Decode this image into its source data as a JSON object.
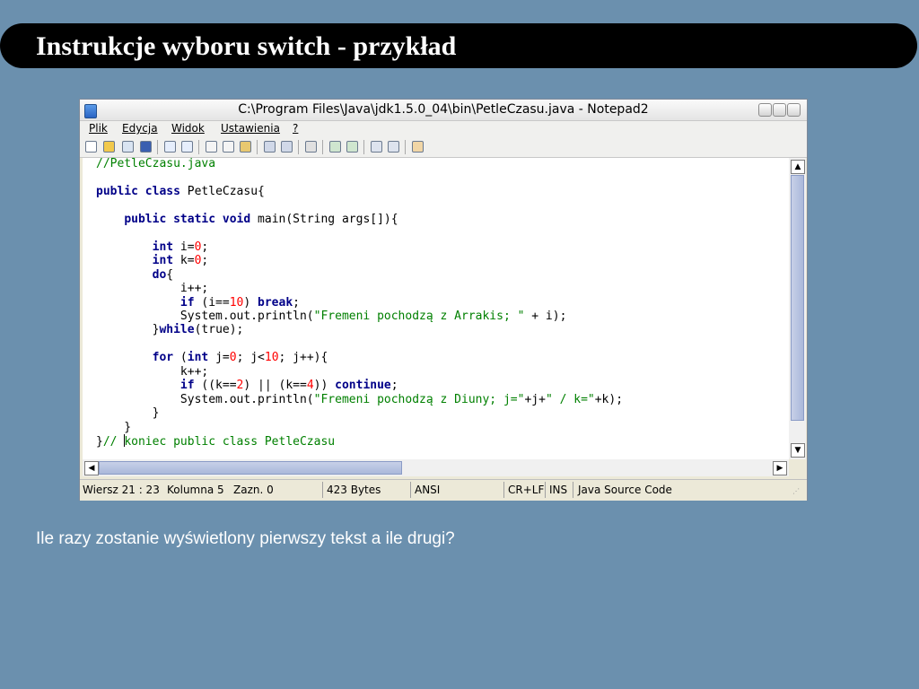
{
  "slide": {
    "title": "Instrukcje wyboru switch - przykład",
    "question": "Ile razy zostanie wyświetlony pierwszy tekst a ile drugi?"
  },
  "window": {
    "title": "C:\\Program Files\\Java\\jdk1.5.0_04\\bin\\PetleCzasu.java - Notepad2",
    "menu": [
      "Plik",
      "Edycja",
      "Widok",
      "Ustawienia",
      "?"
    ]
  },
  "statusbar": {
    "position": "Wiersz 21 : 23",
    "column": "Kolumna 5",
    "selection": "Zazn. 0",
    "size": "423 Bytes",
    "encoding": "ANSI",
    "line_endings": "CR+LF",
    "mode": "INS",
    "language": "Java Source Code"
  },
  "code": {
    "lines": [
      [
        {
          "t": "//PetleCzasu.java",
          "c": "com"
        }
      ],
      [],
      [
        {
          "t": "public",
          "c": "kw"
        },
        {
          "t": " "
        },
        {
          "t": "class",
          "c": "kw"
        },
        {
          "t": " PetleCzasu{"
        }
      ],
      [],
      [
        {
          "t": "    "
        },
        {
          "t": "public",
          "c": "kw"
        },
        {
          "t": " "
        },
        {
          "t": "static",
          "c": "kw"
        },
        {
          "t": " "
        },
        {
          "t": "void",
          "c": "kw"
        },
        {
          "t": " main(String args[]){"
        }
      ],
      [],
      [
        {
          "t": "        "
        },
        {
          "t": "int",
          "c": "kw"
        },
        {
          "t": " i="
        },
        {
          "t": "0",
          "c": "num"
        },
        {
          "t": ";"
        }
      ],
      [
        {
          "t": "        "
        },
        {
          "t": "int",
          "c": "kw"
        },
        {
          "t": " k="
        },
        {
          "t": "0",
          "c": "num"
        },
        {
          "t": ";"
        }
      ],
      [
        {
          "t": "        "
        },
        {
          "t": "do",
          "c": "kw"
        },
        {
          "t": "{"
        }
      ],
      [
        {
          "t": "            i++;"
        }
      ],
      [
        {
          "t": "            "
        },
        {
          "t": "if",
          "c": "kw"
        },
        {
          "t": " (i=="
        },
        {
          "t": "10",
          "c": "num"
        },
        {
          "t": ") "
        },
        {
          "t": "break",
          "c": "kw"
        },
        {
          "t": ";"
        }
      ],
      [
        {
          "t": "            System.out.println("
        },
        {
          "t": "\"Fremeni pochodzą z Arrakis; \"",
          "c": "str"
        },
        {
          "t": " + i);"
        }
      ],
      [
        {
          "t": "        }"
        },
        {
          "t": "while",
          "c": "kw"
        },
        {
          "t": "(true);"
        }
      ],
      [],
      [
        {
          "t": "        "
        },
        {
          "t": "for",
          "c": "kw"
        },
        {
          "t": " ("
        },
        {
          "t": "int",
          "c": "kw"
        },
        {
          "t": " j="
        },
        {
          "t": "0",
          "c": "num"
        },
        {
          "t": "; j<"
        },
        {
          "t": "10",
          "c": "num"
        },
        {
          "t": "; j++){"
        }
      ],
      [
        {
          "t": "            k++;"
        }
      ],
      [
        {
          "t": "            "
        },
        {
          "t": "if",
          "c": "kw"
        },
        {
          "t": " ((k=="
        },
        {
          "t": "2",
          "c": "num"
        },
        {
          "t": ") || (k=="
        },
        {
          "t": "4",
          "c": "num"
        },
        {
          "t": ")) "
        },
        {
          "t": "continue",
          "c": "kw"
        },
        {
          "t": ";"
        }
      ],
      [
        {
          "t": "            System.out.println("
        },
        {
          "t": "\"Fremeni pochodzą z Diuny; j=\"",
          "c": "str"
        },
        {
          "t": "+j+"
        },
        {
          "t": "\" / k=\"",
          "c": "str"
        },
        {
          "t": "+k);"
        }
      ],
      [
        {
          "t": "        }"
        }
      ],
      [
        {
          "t": "    }"
        }
      ],
      [
        {
          "t": "}"
        },
        {
          "t": "// ",
          "c": "com"
        },
        {
          "caret": true
        },
        {
          "t": "koniec public class PetleCzasu",
          "c": "com"
        }
      ]
    ]
  }
}
